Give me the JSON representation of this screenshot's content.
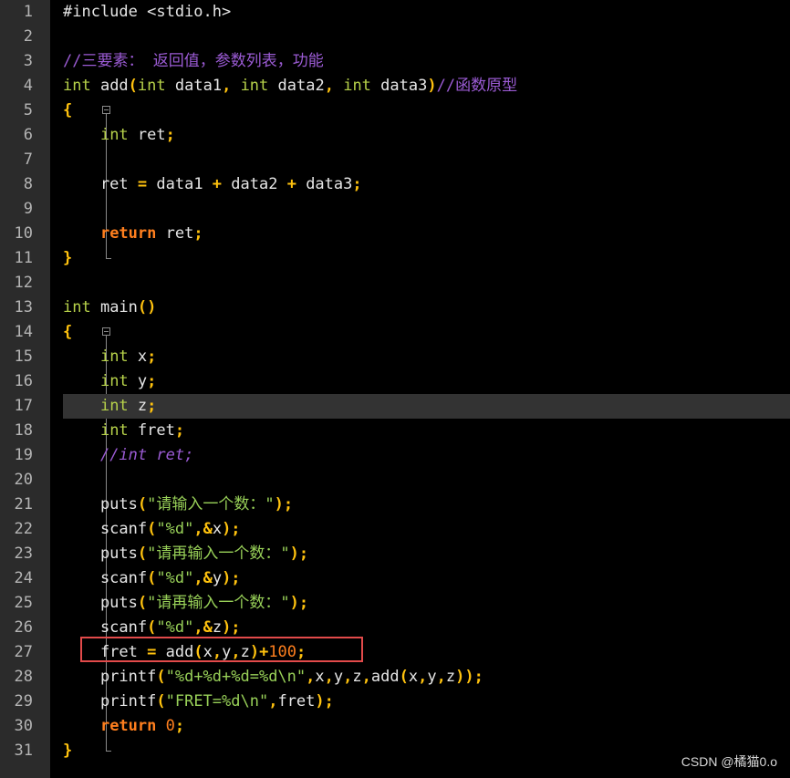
{
  "editor": {
    "lines": [
      {
        "n": "1",
        "tokens": [
          {
            "t": "#include <stdio.h>",
            "c": "pp"
          }
        ]
      },
      {
        "n": "2",
        "tokens": []
      },
      {
        "n": "3",
        "tokens": [
          {
            "t": "//三要素： 返回值，参数列表，功能",
            "c": "cm"
          }
        ]
      },
      {
        "n": "4",
        "tokens": [
          {
            "t": "int",
            "c": "kw"
          },
          {
            "t": " add",
            "c": "id"
          },
          {
            "t": "(",
            "c": "op"
          },
          {
            "t": "int",
            "c": "kw"
          },
          {
            "t": " data1",
            "c": "id"
          },
          {
            "t": ",",
            "c": "op"
          },
          {
            "t": " ",
            "c": "id"
          },
          {
            "t": "int",
            "c": "kw"
          },
          {
            "t": " data2",
            "c": "id"
          },
          {
            "t": ",",
            "c": "op"
          },
          {
            "t": " ",
            "c": "id"
          },
          {
            "t": "int",
            "c": "kw"
          },
          {
            "t": " data3",
            "c": "id"
          },
          {
            "t": ")",
            "c": "op"
          },
          {
            "t": "//函数原型",
            "c": "cm"
          }
        ]
      },
      {
        "n": "5",
        "tokens": [
          {
            "t": "{",
            "c": "op"
          }
        ]
      },
      {
        "n": "6",
        "tokens": [
          {
            "t": "    ",
            "c": "id"
          },
          {
            "t": "int",
            "c": "kw"
          },
          {
            "t": " ret",
            "c": "id"
          },
          {
            "t": ";",
            "c": "op"
          }
        ]
      },
      {
        "n": "7",
        "tokens": []
      },
      {
        "n": "8",
        "tokens": [
          {
            "t": "    ret ",
            "c": "id"
          },
          {
            "t": "=",
            "c": "op"
          },
          {
            "t": " data1 ",
            "c": "id"
          },
          {
            "t": "+",
            "c": "op"
          },
          {
            "t": " data2 ",
            "c": "id"
          },
          {
            "t": "+",
            "c": "op"
          },
          {
            "t": " data3",
            "c": "id"
          },
          {
            "t": ";",
            "c": "op"
          }
        ]
      },
      {
        "n": "9",
        "tokens": []
      },
      {
        "n": "10",
        "tokens": [
          {
            "t": "    ",
            "c": "id"
          },
          {
            "t": "return",
            "c": "kwb"
          },
          {
            "t": " ret",
            "c": "id"
          },
          {
            "t": ";",
            "c": "op"
          }
        ]
      },
      {
        "n": "11",
        "tokens": [
          {
            "t": "}",
            "c": "op"
          }
        ]
      },
      {
        "n": "12",
        "tokens": []
      },
      {
        "n": "13",
        "tokens": [
          {
            "t": "int",
            "c": "kw"
          },
          {
            "t": " main",
            "c": "id"
          },
          {
            "t": "()",
            "c": "op"
          }
        ]
      },
      {
        "n": "14",
        "tokens": [
          {
            "t": "{",
            "c": "op"
          }
        ]
      },
      {
        "n": "15",
        "tokens": [
          {
            "t": "    ",
            "c": "id"
          },
          {
            "t": "int",
            "c": "kw"
          },
          {
            "t": " x",
            "c": "id"
          },
          {
            "t": ";",
            "c": "op"
          }
        ]
      },
      {
        "n": "16",
        "tokens": [
          {
            "t": "    ",
            "c": "id"
          },
          {
            "t": "int",
            "c": "kw"
          },
          {
            "t": " y",
            "c": "id"
          },
          {
            "t": ";",
            "c": "op"
          }
        ]
      },
      {
        "n": "17",
        "tokens": [
          {
            "t": "    ",
            "c": "id"
          },
          {
            "t": "int",
            "c": "kw"
          },
          {
            "t": " z",
            "c": "id"
          },
          {
            "t": ";",
            "c": "op"
          }
        ],
        "current": true
      },
      {
        "n": "18",
        "tokens": [
          {
            "t": "    ",
            "c": "id"
          },
          {
            "t": "int",
            "c": "kw"
          },
          {
            "t": " fret",
            "c": "id"
          },
          {
            "t": ";",
            "c": "op"
          }
        ]
      },
      {
        "n": "19",
        "tokens": [
          {
            "t": "    ",
            "c": "id"
          },
          {
            "t": "//int ret;",
            "c": "cmi"
          }
        ]
      },
      {
        "n": "20",
        "tokens": []
      },
      {
        "n": "21",
        "tokens": [
          {
            "t": "    puts",
            "c": "id"
          },
          {
            "t": "(",
            "c": "op"
          },
          {
            "t": "\"请输入一个数：\"",
            "c": "str"
          },
          {
            "t": ");",
            "c": "op"
          }
        ]
      },
      {
        "n": "22",
        "tokens": [
          {
            "t": "    scanf",
            "c": "id"
          },
          {
            "t": "(",
            "c": "op"
          },
          {
            "t": "\"%d\"",
            "c": "str"
          },
          {
            "t": ",&",
            "c": "op"
          },
          {
            "t": "x",
            "c": "id"
          },
          {
            "t": ");",
            "c": "op"
          }
        ]
      },
      {
        "n": "23",
        "tokens": [
          {
            "t": "    puts",
            "c": "id"
          },
          {
            "t": "(",
            "c": "op"
          },
          {
            "t": "\"请再输入一个数：\"",
            "c": "str"
          },
          {
            "t": ");",
            "c": "op"
          }
        ]
      },
      {
        "n": "24",
        "tokens": [
          {
            "t": "    scanf",
            "c": "id"
          },
          {
            "t": "(",
            "c": "op"
          },
          {
            "t": "\"%d\"",
            "c": "str"
          },
          {
            "t": ",&",
            "c": "op"
          },
          {
            "t": "y",
            "c": "id"
          },
          {
            "t": ");",
            "c": "op"
          }
        ]
      },
      {
        "n": "25",
        "tokens": [
          {
            "t": "    puts",
            "c": "id"
          },
          {
            "t": "(",
            "c": "op"
          },
          {
            "t": "\"请再输入一个数：\"",
            "c": "str"
          },
          {
            "t": ");",
            "c": "op"
          }
        ]
      },
      {
        "n": "26",
        "tokens": [
          {
            "t": "    scanf",
            "c": "id"
          },
          {
            "t": "(",
            "c": "op"
          },
          {
            "t": "\"%d\"",
            "c": "str"
          },
          {
            "t": ",&",
            "c": "op"
          },
          {
            "t": "z",
            "c": "id"
          },
          {
            "t": ");",
            "c": "op"
          }
        ]
      },
      {
        "n": "27",
        "tokens": [
          {
            "t": "    fret ",
            "c": "id"
          },
          {
            "t": "=",
            "c": "op"
          },
          {
            "t": " add",
            "c": "id"
          },
          {
            "t": "(",
            "c": "op"
          },
          {
            "t": "x",
            "c": "id"
          },
          {
            "t": ",",
            "c": "op"
          },
          {
            "t": "y",
            "c": "id"
          },
          {
            "t": ",",
            "c": "op"
          },
          {
            "t": "z",
            "c": "id"
          },
          {
            "t": ")+",
            "c": "op"
          },
          {
            "t": "100",
            "c": "num"
          },
          {
            "t": ";",
            "c": "op"
          }
        ],
        "boxed": true
      },
      {
        "n": "28",
        "tokens": [
          {
            "t": "    printf",
            "c": "id"
          },
          {
            "t": "(",
            "c": "op"
          },
          {
            "t": "\"%d+%d+%d=%d\\n\"",
            "c": "str"
          },
          {
            "t": ",",
            "c": "op"
          },
          {
            "t": "x",
            "c": "id"
          },
          {
            "t": ",",
            "c": "op"
          },
          {
            "t": "y",
            "c": "id"
          },
          {
            "t": ",",
            "c": "op"
          },
          {
            "t": "z",
            "c": "id"
          },
          {
            "t": ",",
            "c": "op"
          },
          {
            "t": "add",
            "c": "id"
          },
          {
            "t": "(",
            "c": "op"
          },
          {
            "t": "x",
            "c": "id"
          },
          {
            "t": ",",
            "c": "op"
          },
          {
            "t": "y",
            "c": "id"
          },
          {
            "t": ",",
            "c": "op"
          },
          {
            "t": "z",
            "c": "id"
          },
          {
            "t": "));",
            "c": "op"
          }
        ]
      },
      {
        "n": "29",
        "tokens": [
          {
            "t": "    printf",
            "c": "id"
          },
          {
            "t": "(",
            "c": "op"
          },
          {
            "t": "\"FRET=%d\\n\"",
            "c": "str"
          },
          {
            "t": ",",
            "c": "op"
          },
          {
            "t": "fret",
            "c": "id"
          },
          {
            "t": ");",
            "c": "op"
          }
        ]
      },
      {
        "n": "30",
        "tokens": [
          {
            "t": "    ",
            "c": "id"
          },
          {
            "t": "return",
            "c": "kwb"
          },
          {
            "t": " ",
            "c": "id"
          },
          {
            "t": "0",
            "c": "num"
          },
          {
            "t": ";",
            "c": "op"
          }
        ]
      },
      {
        "n": "31",
        "tokens": [
          {
            "t": "}",
            "c": "op"
          }
        ]
      }
    ],
    "current_line_color": "#333333",
    "highlight_color": "#e24a4a"
  },
  "watermark": "CSDN @橘猫0.o"
}
